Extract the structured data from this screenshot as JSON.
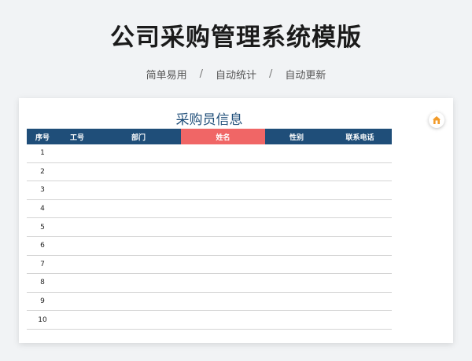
{
  "header": {
    "title": "公司采购管理系统模版",
    "features": [
      "简单易用",
      "自动统计",
      "自动更新"
    ],
    "separator": "/"
  },
  "sheet": {
    "title": "采购员信息",
    "columns": [
      "序号",
      "工号",
      "部门",
      "姓名",
      "性别",
      "联系电话"
    ],
    "highlight_column": "姓名",
    "rows": [
      "1",
      "2",
      "3",
      "4",
      "5",
      "6",
      "7",
      "8",
      "9",
      "10"
    ]
  },
  "colors": {
    "header_bg": "#1f4e79",
    "highlight_bg": "#f06666",
    "title_color": "#1f4e79",
    "icon_color": "#f29b2a"
  },
  "side_button": {
    "icon": "home-icon"
  }
}
